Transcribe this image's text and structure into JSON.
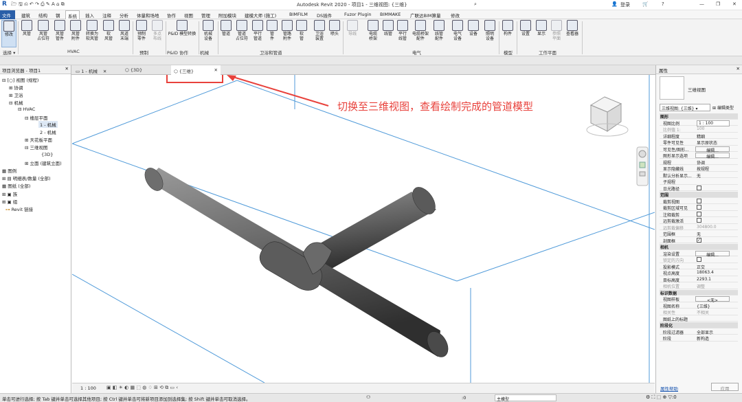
{
  "title_bar": {
    "app_title": "Autodesk Revit 2020 - 项目1 - 三维视图: {三维}",
    "user": "登录",
    "help": "?"
  },
  "ribbon_tabs": [
    "文件",
    "建筑",
    "结构",
    "钢",
    "系统",
    "插入",
    "注释",
    "分析",
    "体量和场地",
    "协作",
    "视图",
    "管理",
    "附加模块",
    "建模大师 (施工)",
    "BIMFILM",
    "DS插件",
    "Fuzor Plugin",
    "BIMMAKE",
    "广联达BIM算量",
    "修改"
  ],
  "ribbon_groups": {
    "select": "选择 ▾",
    "hvac": "HVAC",
    "prefab": "预制",
    "pid": "P&ID 协作",
    "mech": "机械",
    "plumbing": "卫浴和管道",
    "electrical": "电气",
    "model": "模型",
    "workplane": "工作平面"
  },
  "ribbon_tools": {
    "modify": "修改",
    "duct": "风管",
    "duct_placeholder": "风管\n占位符",
    "duct_fitting": "风管\n管件",
    "duct_accessory": "风管\n附件",
    "convert_flex": "转换为\n软风管",
    "flex_duct": "软\n风管",
    "air_terminal": "风道\n末端",
    "fabrication_part": "预制\n零件",
    "multipoint_routing": "多点\n布线",
    "pid_conversion": "P&ID 模型转换",
    "mech_equipment": "机械\n设备",
    "pipe": "管道",
    "pipe_placeholder": "管道\n占位符",
    "parallel_pipes": "平行\n管道",
    "pipe_fitting": "管\n件",
    "pipe_accessory": "管路\n附件",
    "flex_pipe": "软\n管",
    "plumbing_fixture": "卫浴\n装置",
    "sprinkler": "喷头",
    "wire": "导线",
    "cable_tray": "电缆\n桥架",
    "conduit": "线管",
    "parallel_conduits": "平行\n线管",
    "cable_tray_fitting": "电缆桥架\n配件",
    "conduit_fitting": "线管\n配件",
    "elec_equipment": "电气\n设备",
    "device": "设备",
    "lighting_fixture": "照明\n设备",
    "component": "构件",
    "set": "设置",
    "show": "显示",
    "ref_plane": "参照\n平面",
    "viewer": "查看器"
  },
  "project_browser": {
    "title": "项目浏览器 - 项目1",
    "items": [
      {
        "label": "[○] 视图 (规程)"
      },
      {
        "label": "协调"
      },
      {
        "label": "卫浴"
      },
      {
        "label": "机械"
      },
      {
        "label": "HVAC"
      },
      {
        "label": "楼层平面"
      },
      {
        "label": "1 - 机械"
      },
      {
        "label": "2 - 机械"
      },
      {
        "label": "天花板平面"
      },
      {
        "label": "三维视图"
      },
      {
        "label": "{3D}"
      },
      {
        "label": "立面 (建筑立面)"
      },
      {
        "label": "图例"
      },
      {
        "label": "明细表/数量 (全部)"
      },
      {
        "label": "图纸 (全部)"
      },
      {
        "label": "族"
      },
      {
        "label": "组"
      },
      {
        "label": "Revit 链接"
      }
    ]
  },
  "view_tabs": [
    {
      "label": "1 - 机械"
    },
    {
      "label": "{3D}"
    },
    {
      "label": "{三维}"
    }
  ],
  "annotation": "切换至三维视图，查看绘制完成的管道模型",
  "view_control_bar": {
    "scale": "1 : 100"
  },
  "properties": {
    "title": "属性",
    "type_name": "三维视图",
    "instance_selector": "三维视图: {三维}",
    "edit_type": "编辑类型",
    "help_link": "属性帮助",
    "apply": "应用",
    "sections": [
      {
        "name": "图形",
        "rows": [
          {
            "k": "视图比例",
            "v": "1 : 100",
            "type": "input"
          },
          {
            "k": "比例值 1:",
            "v": "100",
            "type": "text",
            "gray": true
          },
          {
            "k": "详细程度",
            "v": "精细",
            "type": "text"
          },
          {
            "k": "零件可见性",
            "v": "显示原状态",
            "type": "text"
          },
          {
            "k": "可见性/图形...",
            "v": "编辑...",
            "type": "button"
          },
          {
            "k": "图形显示选项",
            "v": "编辑...",
            "type": "button"
          },
          {
            "k": "规程",
            "v": "协调",
            "type": "text"
          },
          {
            "k": "显示隐藏线",
            "v": "按规程",
            "type": "text"
          },
          {
            "k": "默认分析显示...",
            "v": "无",
            "type": "text"
          },
          {
            "k": "子规程",
            "v": "",
            "type": "text"
          },
          {
            "k": "日光路径",
            "v": "",
            "type": "checkbox",
            "checked": false
          }
        ]
      },
      {
        "name": "范围",
        "rows": [
          {
            "k": "裁剪视图",
            "v": "",
            "type": "checkbox",
            "checked": false
          },
          {
            "k": "裁剪区域可见",
            "v": "",
            "type": "checkbox",
            "checked": false
          },
          {
            "k": "注释裁剪",
            "v": "",
            "type": "checkbox",
            "checked": false
          },
          {
            "k": "远剪裁激活",
            "v": "",
            "type": "checkbox",
            "checked": false
          },
          {
            "k": "远剪裁偏移",
            "v": "304800.0",
            "type": "text",
            "gray": true
          },
          {
            "k": "范围框",
            "v": "无",
            "type": "text"
          },
          {
            "k": "剖面框",
            "v": "",
            "type": "checkbox",
            "checked": true
          }
        ]
      },
      {
        "name": "相机",
        "rows": [
          {
            "k": "渲染设置",
            "v": "编辑...",
            "type": "button"
          },
          {
            "k": "锁定的方向",
            "v": "",
            "type": "checkbox",
            "checked": false,
            "gray": true
          },
          {
            "k": "投影模式",
            "v": "正交",
            "type": "text"
          },
          {
            "k": "视点高度",
            "v": "18063.4",
            "type": "text"
          },
          {
            "k": "目标高度",
            "v": "2293.1",
            "type": "text"
          },
          {
            "k": "相机位置",
            "v": "调整",
            "type": "text",
            "gray": true
          }
        ]
      },
      {
        "name": "标识数据",
        "rows": [
          {
            "k": "视图样板",
            "v": "<无>",
            "type": "button"
          },
          {
            "k": "视图名称",
            "v": "{三维}",
            "type": "text"
          },
          {
            "k": "相关性",
            "v": "不相关",
            "type": "text",
            "gray": true
          },
          {
            "k": "图纸上的标题",
            "v": "",
            "type": "text"
          }
        ]
      },
      {
        "name": "阶段化",
        "rows": [
          {
            "k": "阶段过滤器",
            "v": "全部显示",
            "type": "text"
          },
          {
            "k": "阶段",
            "v": "新构造",
            "type": "text"
          }
        ]
      }
    ]
  },
  "status_bar": {
    "message": "单击可进行选择; 按 Tab 键并单击可选择其他项目; 按 Ctrl 键并单击可将新项目添加到选择集; 按 Shift 键并单击可取消选择。",
    "zero": ":0",
    "model": "主模型"
  },
  "colors": {
    "ribbon_active_tab": "#2a5fa8",
    "annotation_red": "#e8413b",
    "section_box": "#4f9ad9",
    "pipe": "#6a6a6a"
  }
}
